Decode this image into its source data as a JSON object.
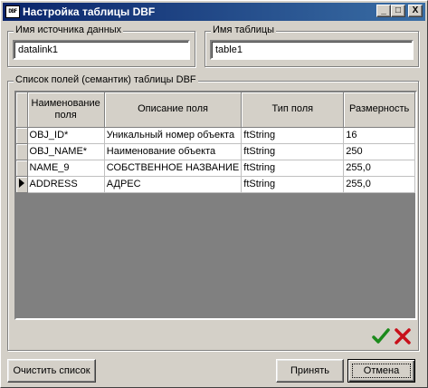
{
  "window": {
    "title": "Настройка таблицы DBF",
    "icon_text": "DBF",
    "controls": [
      "_",
      "□",
      "X"
    ]
  },
  "datasource": {
    "label": "Имя источника данных",
    "value": "datalink1"
  },
  "table_name": {
    "label": "Имя таблицы",
    "value": "table1"
  },
  "fields": {
    "label": "Список полей (семантик) таблицы DBF",
    "columns": [
      "Наименование поля",
      "Описание поля",
      "Тип поля",
      "Размерность"
    ],
    "rows": [
      [
        "OBJ_ID*",
        "Уникальный номер объекта",
        "ftString",
        "16"
      ],
      [
        "OBJ_NAME*",
        "Наименование объекта",
        "ftString",
        "250"
      ],
      [
        "NAME_9",
        "СОБСТВЕННОЕ НАЗВАНИЕ",
        "ftString",
        "255,0"
      ],
      [
        "ADDRESS",
        "АДРЕС",
        "ftString",
        "255,0"
      ]
    ],
    "current_row": 3
  },
  "icons": {
    "apply": "check-icon",
    "delete": "cross-icon",
    "apply_color": "#1c8a1c",
    "delete_color": "#c8101a"
  },
  "buttons": {
    "clear": "Очистить список",
    "accept": "Принять",
    "cancel": "Отмена"
  }
}
